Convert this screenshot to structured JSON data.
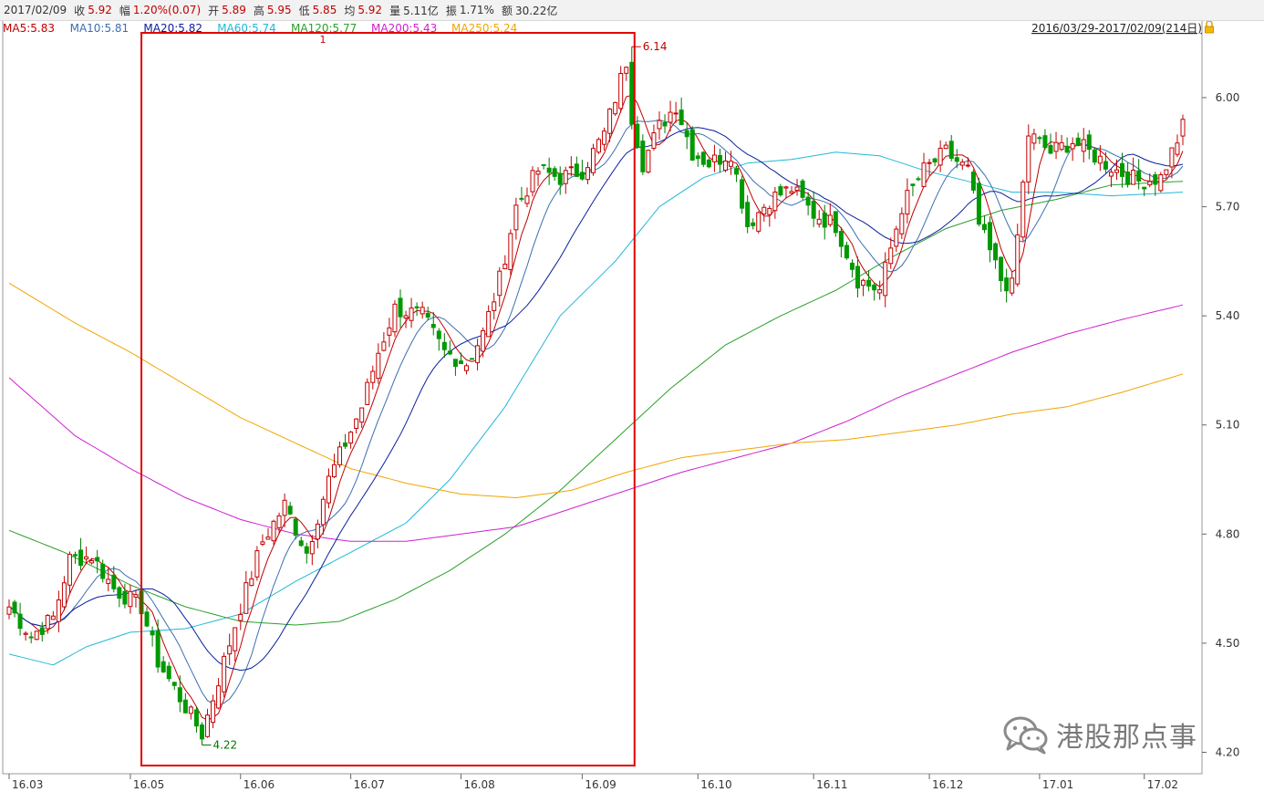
{
  "infobar": {
    "date": "2017/02/09",
    "close_label": "收",
    "close": "5.92",
    "change_label": "幅",
    "change": "1.20%(0.07)",
    "open_label": "开",
    "open": "5.89",
    "high_label": "高",
    "high": "5.95",
    "low_label": "低",
    "low": "5.85",
    "avg_label": "均",
    "avg": "5.92",
    "volume_label": "量",
    "volume": "5.11亿",
    "amplitude_label": "振",
    "amplitude": "1.71%",
    "turnover_label": "额",
    "turnover": "30.22亿"
  },
  "range_label": "2016/03/29-2017/02/09(214日)",
  "watermark": "港股那点事",
  "highlight_marker": "1",
  "chart_data": {
    "type": "candlestick",
    "ylim": [
      4.16,
      6.29
    ],
    "y_ticks": [
      "6.00",
      "5.70",
      "5.40",
      "5.10",
      "4.80",
      "4.50",
      "4.20"
    ],
    "x_ticks": [
      "16.03",
      "16.05",
      "16.06",
      "16.07",
      "16.08",
      "16.09",
      "16.10",
      "16.11",
      "16.12",
      "17.01",
      "17.02"
    ],
    "x_tick_days": [
      0,
      22,
      42,
      62,
      82,
      104,
      125,
      146,
      167,
      187,
      206
    ],
    "n_days": 214,
    "annotations": [
      {
        "label": "6.14",
        "day": 113,
        "value": 6.14,
        "type": "high"
      },
      {
        "label": "4.22",
        "day": 35,
        "value": 4.22,
        "type": "low"
      }
    ],
    "highlight_range_days": [
      25,
      113
    ],
    "ma_legend": [
      {
        "name": "MA5",
        "value": "5.83",
        "color": "#c00000"
      },
      {
        "name": "MA10",
        "value": "5.81",
        "color": "#3a6fb0"
      },
      {
        "name": "MA20",
        "value": "5.82",
        "color": "#0a1f9c"
      },
      {
        "name": "MA60",
        "value": "5.74",
        "color": "#20b8d8"
      },
      {
        "name": "MA120",
        "value": "5.77",
        "color": "#2aa02a"
      },
      {
        "name": "MA200",
        "value": "5.43",
        "color": "#d020d0"
      },
      {
        "name": "MA250",
        "value": "5.24",
        "color": "#f0a500"
      }
    ],
    "close_anchors": [
      [
        0,
        4.6
      ],
      [
        4,
        4.52
      ],
      [
        8,
        4.57
      ],
      [
        11,
        4.73
      ],
      [
        15,
        4.74
      ],
      [
        19,
        4.65
      ],
      [
        24,
        4.6
      ],
      [
        27,
        4.45
      ],
      [
        31,
        4.35
      ],
      [
        35,
        4.25
      ],
      [
        38,
        4.4
      ],
      [
        42,
        4.6
      ],
      [
        46,
        4.78
      ],
      [
        50,
        4.88
      ],
      [
        54,
        4.75
      ],
      [
        58,
        4.95
      ],
      [
        61,
        5.05
      ],
      [
        64,
        5.15
      ],
      [
        67,
        5.3
      ],
      [
        70,
        5.42
      ],
      [
        75,
        5.4
      ],
      [
        79,
        5.3
      ],
      [
        83,
        5.27
      ],
      [
        86,
        5.35
      ],
      [
        89,
        5.5
      ],
      [
        92,
        5.7
      ],
      [
        96,
        5.8
      ],
      [
        100,
        5.78
      ],
      [
        104,
        5.8
      ],
      [
        108,
        5.9
      ],
      [
        110,
        6.0
      ],
      [
        112,
        6.1
      ],
      [
        113,
        5.95
      ],
      [
        115,
        5.82
      ],
      [
        118,
        5.92
      ],
      [
        121,
        5.98
      ],
      [
        124,
        5.85
      ],
      [
        127,
        5.82
      ],
      [
        131,
        5.85
      ],
      [
        134,
        5.65
      ],
      [
        138,
        5.72
      ],
      [
        142,
        5.75
      ],
      [
        146,
        5.68
      ],
      [
        150,
        5.65
      ],
      [
        154,
        5.5
      ],
      [
        158,
        5.47
      ],
      [
        162,
        5.7
      ],
      [
        166,
        5.8
      ],
      [
        170,
        5.85
      ],
      [
        174,
        5.8
      ],
      [
        176,
        5.65
      ],
      [
        180,
        5.5
      ],
      [
        182,
        5.48
      ],
      [
        185,
        5.9
      ],
      [
        189,
        5.85
      ],
      [
        193,
        5.88
      ],
      [
        197,
        5.84
      ],
      [
        201,
        5.8
      ],
      [
        205,
        5.77
      ],
      [
        209,
        5.78
      ],
      [
        213,
        5.92
      ]
    ],
    "ma_series": {
      "MA60": [
        [
          0,
          4.47
        ],
        [
          8,
          4.44
        ],
        [
          14,
          4.49
        ],
        [
          22,
          4.53
        ],
        [
          32,
          4.54
        ],
        [
          42,
          4.58
        ],
        [
          52,
          4.67
        ],
        [
          62,
          4.75
        ],
        [
          72,
          4.83
        ],
        [
          80,
          4.95
        ],
        [
          90,
          5.15
        ],
        [
          100,
          5.4
        ],
        [
          110,
          5.55
        ],
        [
          118,
          5.7
        ],
        [
          126,
          5.78
        ],
        [
          134,
          5.82
        ],
        [
          142,
          5.83
        ],
        [
          150,
          5.85
        ],
        [
          158,
          5.84
        ],
        [
          166,
          5.8
        ],
        [
          174,
          5.77
        ],
        [
          182,
          5.74
        ],
        [
          190,
          5.74
        ],
        [
          200,
          5.73
        ],
        [
          213,
          5.74
        ]
      ],
      "MA120": [
        [
          0,
          4.81
        ],
        [
          10,
          4.75
        ],
        [
          22,
          4.66
        ],
        [
          32,
          4.6
        ],
        [
          42,
          4.56
        ],
        [
          52,
          4.55
        ],
        [
          60,
          4.56
        ],
        [
          70,
          4.62
        ],
        [
          80,
          4.7
        ],
        [
          90,
          4.8
        ],
        [
          100,
          4.92
        ],
        [
          110,
          5.06
        ],
        [
          120,
          5.2
        ],
        [
          130,
          5.32
        ],
        [
          140,
          5.4
        ],
        [
          150,
          5.47
        ],
        [
          160,
          5.56
        ],
        [
          170,
          5.64
        ],
        [
          180,
          5.69
        ],
        [
          190,
          5.72
        ],
        [
          200,
          5.76
        ],
        [
          213,
          5.77
        ]
      ],
      "MA200": [
        [
          0,
          5.23
        ],
        [
          12,
          5.07
        ],
        [
          22,
          4.98
        ],
        [
          32,
          4.9
        ],
        [
          42,
          4.84
        ],
        [
          52,
          4.8
        ],
        [
          62,
          4.78
        ],
        [
          72,
          4.78
        ],
        [
          82,
          4.8
        ],
        [
          92,
          4.82
        ],
        [
          102,
          4.87
        ],
        [
          112,
          4.92
        ],
        [
          122,
          4.97
        ],
        [
          132,
          5.01
        ],
        [
          142,
          5.05
        ],
        [
          152,
          5.11
        ],
        [
          162,
          5.18
        ],
        [
          172,
          5.24
        ],
        [
          182,
          5.3
        ],
        [
          192,
          5.35
        ],
        [
          202,
          5.39
        ],
        [
          213,
          5.43
        ]
      ],
      "MA250": [
        [
          0,
          5.49
        ],
        [
          12,
          5.38
        ],
        [
          22,
          5.3
        ],
        [
          32,
          5.21
        ],
        [
          42,
          5.12
        ],
        [
          52,
          5.05
        ],
        [
          62,
          4.98
        ],
        [
          72,
          4.94
        ],
        [
          82,
          4.91
        ],
        [
          92,
          4.9
        ],
        [
          102,
          4.92
        ],
        [
          112,
          4.97
        ],
        [
          122,
          5.01
        ],
        [
          132,
          5.03
        ],
        [
          142,
          5.05
        ],
        [
          152,
          5.06
        ],
        [
          162,
          5.08
        ],
        [
          172,
          5.1
        ],
        [
          182,
          5.13
        ],
        [
          192,
          5.15
        ],
        [
          202,
          5.19
        ],
        [
          213,
          5.24
        ]
      ]
    }
  }
}
